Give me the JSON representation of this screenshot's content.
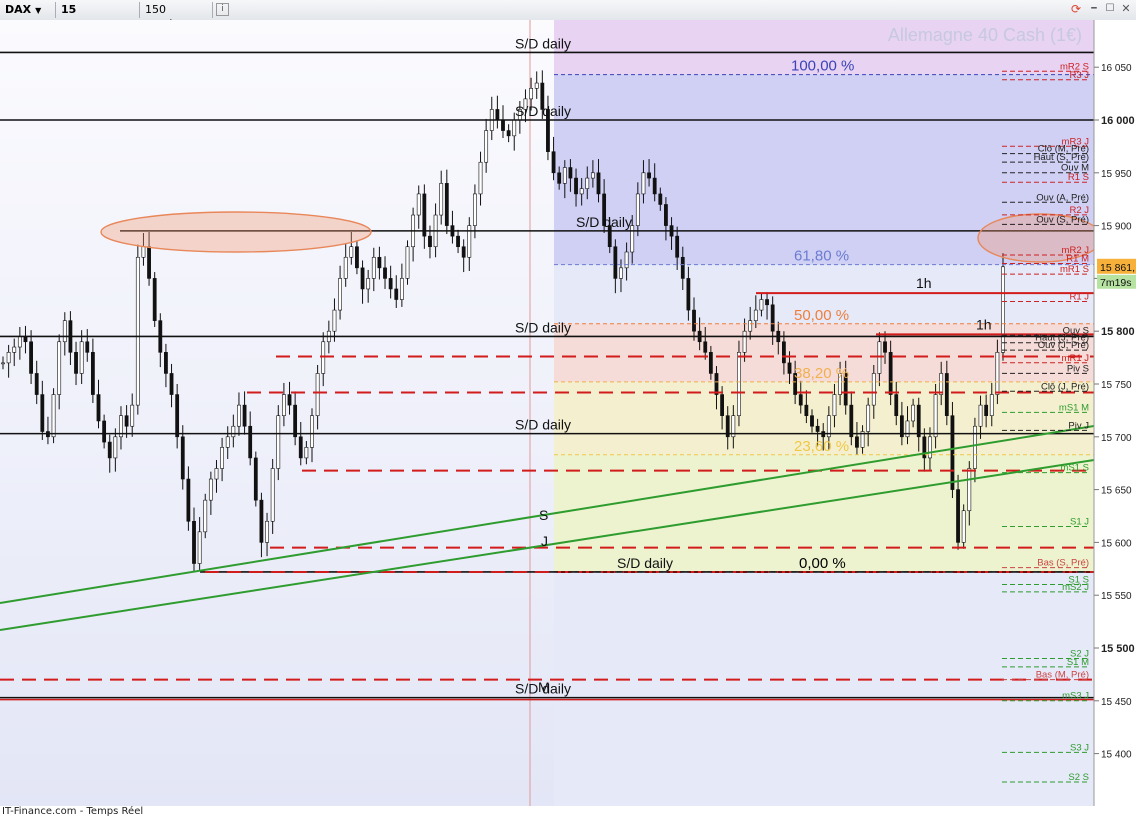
{
  "toolbar": {
    "symbol": "DAX",
    "timeframe": "15 minutes",
    "units": "150 unités",
    "info_icon": "info-icon",
    "refresh_icon": "refresh-icon",
    "window_icons": [
      "minimize-icon",
      "maximize-icon",
      "close-icon"
    ]
  },
  "footer": {
    "source": "IT-Finance.com - Temps Réel"
  },
  "chart_data": {
    "type": "candlestick",
    "title": "Allemagne 40 Cash (1€)",
    "y_ticks": [
      "16 050",
      "16 000",
      "15 950",
      "15 900",
      "15 850",
      "15 800",
      "15 750",
      "15 700",
      "15 650",
      "15 600",
      "15 550",
      "15 500",
      "15 450",
      "15 400"
    ],
    "y_tick_values": [
      16050,
      16000,
      15950,
      15900,
      15850,
      15800,
      15750,
      15700,
      15650,
      15600,
      15550,
      15500,
      15450,
      15400
    ],
    "y_tick_bold": [
      16000,
      15800,
      15500
    ],
    "ylim": [
      15380,
      16090
    ],
    "last_price": "15 861,",
    "countdown": "7m19s",
    "colors": {
      "bg_left": "#f3f4fb",
      "bg_right": "#e6e9f8",
      "zone_top": "#cfd0f4",
      "zone_purple": "#e8d3f3",
      "zone_pink": "#f6dcd8",
      "zone_yellow": "#f4f0cf",
      "zone_green": "#edf3cf",
      "red": "#d21b1b",
      "green": "#2e9c2e",
      "black": "#111111",
      "fib_blue": "#5566bb",
      "fib_orange": "#ef8a4a"
    },
    "fib_levels": [
      {
        "label": "100,00 %",
        "value": 16043,
        "color": "#3b43b8"
      },
      {
        "label": "61,80 %",
        "value": 15863,
        "color": "#6c7bd2"
      },
      {
        "label": "50,00 %",
        "value": 15807,
        "color": "#ef7e3c"
      },
      {
        "label": "38,20 %",
        "value": 15752,
        "color": "#f0b050"
      },
      {
        "label": "23,60 %",
        "value": 15683,
        "color": "#f0c848"
      },
      {
        "label": "0,00 %",
        "value": 15572,
        "color": "#000000"
      }
    ],
    "sd_daily_levels": [
      {
        "label": "S/D daily",
        "value": 16064
      },
      {
        "label": "S/D daily",
        "value": 16000
      },
      {
        "label": "S/D daily",
        "value": 15895
      },
      {
        "label": "S/D daily",
        "value": 15795
      },
      {
        "label": "S/D daily",
        "value": 15703
      },
      {
        "label": "S/D daily",
        "value": 15572
      },
      {
        "label": "S/D daily",
        "value": 15453
      }
    ],
    "red_dashed_levels": [
      15776,
      15742,
      15668,
      15595,
      15572,
      15470
    ],
    "h1_levels": [
      {
        "label": "1h",
        "value": 15836
      },
      {
        "label": "1h",
        "value": 15797
      }
    ],
    "trendline_labels": [
      "S",
      "J"
    ],
    "marker_M": "M",
    "pivot_labels": [
      {
        "label": "mR2 S",
        "value": 16048,
        "color": "#cc2222"
      },
      {
        "label": "R3 J",
        "value": 16040,
        "color": "#cc2222"
      },
      {
        "label": "mR3 J",
        "value": 15977,
        "color": "#cc2222"
      },
      {
        "label": "Clô (M, Pré)",
        "value": 15970,
        "color": "#222222"
      },
      {
        "label": "Haut (S, Pré)",
        "value": 15962,
        "color": "#222222"
      },
      {
        "label": "Ouv M",
        "value": 15952,
        "color": "#222222"
      },
      {
        "label": "R1 S",
        "value": 15943,
        "color": "#cc2222"
      },
      {
        "label": "Ouv (A, Pré)",
        "value": 15924,
        "color": "#222222"
      },
      {
        "label": "R2 J",
        "value": 15912,
        "color": "#cc2222"
      },
      {
        "label": "Ouv (S, Pré)",
        "value": 15903,
        "color": "#222222"
      },
      {
        "label": "mR2 J",
        "value": 15874,
        "color": "#cc2222"
      },
      {
        "label": "R1 M",
        "value": 15866,
        "color": "#cc2222"
      },
      {
        "label": "mR1 S",
        "value": 15856,
        "color": "#cc2222"
      },
      {
        "label": "R1 J",
        "value": 15830,
        "color": "#cc2222"
      },
      {
        "label": "Ouv S",
        "value": 15798,
        "color": "#222222"
      },
      {
        "label": "Haut (J, Pré)",
        "value": 15791,
        "color": "#222222"
      },
      {
        "label": "Ouv (J, Pré)",
        "value": 15784,
        "color": "#222222"
      },
      {
        "label": "mR1 J",
        "value": 15772,
        "color": "#cc2222"
      },
      {
        "label": "Piv S",
        "value": 15762,
        "color": "#222222"
      },
      {
        "label": "Clô (J, Pré)",
        "value": 15745,
        "color": "#222222"
      },
      {
        "label": "mS1 M",
        "value": 15725,
        "color": "#2e9c2e"
      },
      {
        "label": "Piv J",
        "value": 15708,
        "color": "#222222"
      },
      {
        "label": "mS1 S",
        "value": 15668,
        "color": "#2e9c2e"
      },
      {
        "label": "S1 J",
        "value": 15617,
        "color": "#2e9c2e"
      },
      {
        "label": "Bas (S, Pré)",
        "value": 15578,
        "color": "#cc4444"
      },
      {
        "label": "S1 S",
        "value": 15562,
        "color": "#2e9c2e"
      },
      {
        "label": "mS2 J",
        "value": 15555,
        "color": "#2e9c2e"
      },
      {
        "label": "S2 J",
        "value": 15492,
        "color": "#2e9c2e"
      },
      {
        "label": "S1 M",
        "value": 15484,
        "color": "#2e9c2e"
      },
      {
        "label": "Bas (M, Pré)",
        "value": 15472,
        "color": "#cc4444"
      },
      {
        "label": "mS3 J",
        "value": 15452,
        "color": "#2e9c2e"
      },
      {
        "label": "S3 J",
        "value": 15403,
        "color": "#2e9c2e"
      },
      {
        "label": "S2 S",
        "value": 15375,
        "color": "#2e9c2e"
      }
    ],
    "closes": [
      15770,
      15780,
      15785,
      15795,
      15790,
      15760,
      15740,
      15705,
      15700,
      15740,
      15790,
      15810,
      15780,
      15760,
      15790,
      15780,
      15740,
      15715,
      15695,
      15680,
      15700,
      15720,
      15710,
      15730,
      15870,
      15880,
      15850,
      15810,
      15780,
      15760,
      15740,
      15700,
      15660,
      15620,
      15580,
      15610,
      15640,
      15660,
      15670,
      15690,
      15700,
      15710,
      15730,
      15710,
      15680,
      15640,
      15600,
      15620,
      15670,
      15720,
      15740,
      15730,
      15700,
      15680,
      15690,
      15720,
      15760,
      15790,
      15800,
      15820,
      15850,
      15870,
      15880,
      15860,
      15840,
      15850,
      15870,
      15860,
      15850,
      15840,
      15830,
      15850,
      15880,
      15910,
      15930,
      15890,
      15880,
      15910,
      15940,
      15900,
      15890,
      15880,
      15870,
      15900,
      15930,
      15960,
      15990,
      16010,
      16000,
      15990,
      15985,
      16000,
      16010,
      16020,
      16030,
      16035,
      16010,
      15970,
      15950,
      15940,
      15955,
      15945,
      15930,
      15935,
      15945,
      15950,
      15930,
      15900,
      15880,
      15850,
      15860,
      15875,
      15900,
      15930,
      15950,
      15945,
      15930,
      15920,
      15900,
      15890,
      15870,
      15850,
      15820,
      15800,
      15790,
      15780,
      15760,
      15740,
      15720,
      15700,
      15720,
      15780,
      15800,
      15810,
      15820,
      15830,
      15825,
      15800,
      15790,
      15770,
      15760,
      15740,
      15730,
      15720,
      15710,
      15705,
      15700,
      15720,
      15740,
      15760,
      15730,
      15700,
      15690,
      15705,
      15730,
      15760,
      15790,
      15780,
      15740,
      15720,
      15700,
      15715,
      15730,
      15700,
      15680,
      15700,
      15740,
      15760,
      15720,
      15650,
      15600,
      15630,
      15670,
      15710,
      15730,
      15720,
      15740,
      15780,
      15861
    ],
    "markers": {
      "cursor_time_line": "vertical guide",
      "ellipses": [
        "resistance zone left",
        "resistance zone right"
      ]
    }
  }
}
